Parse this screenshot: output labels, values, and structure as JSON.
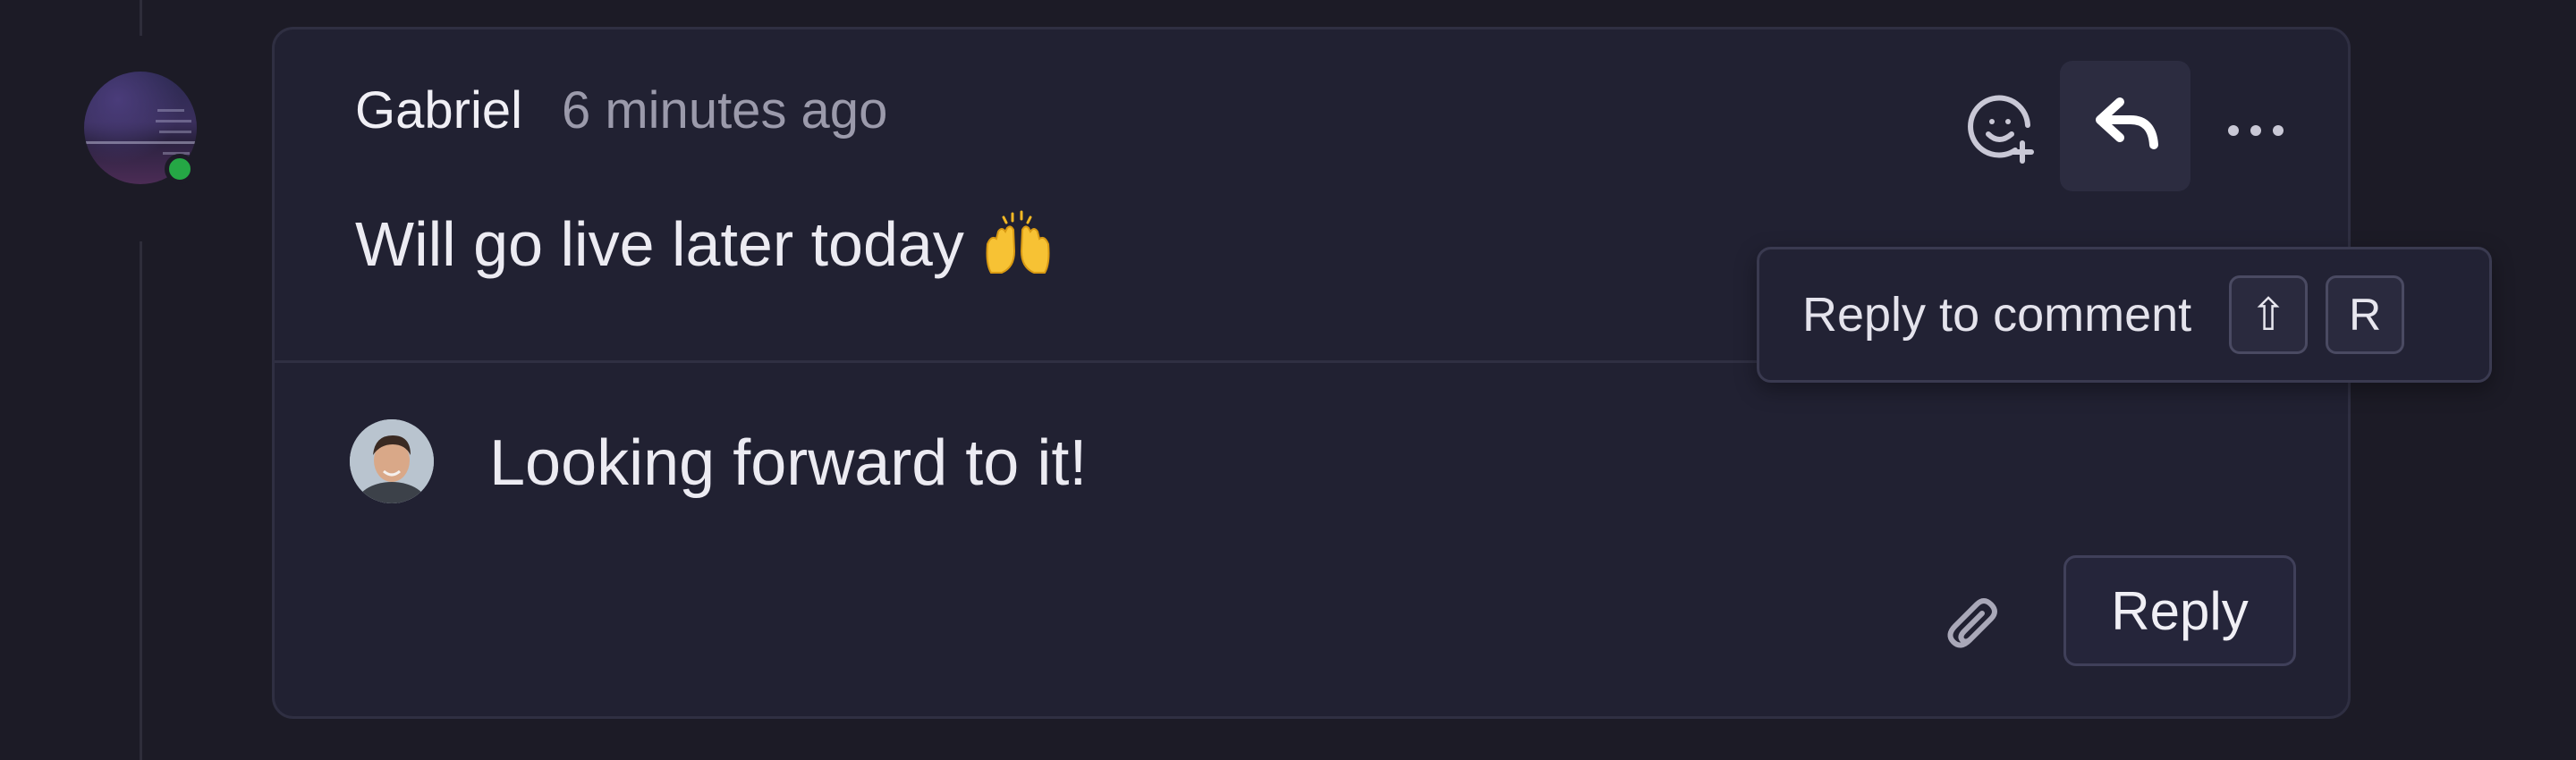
{
  "comment": {
    "author": "Gabriel",
    "timestamp": "6 minutes ago",
    "body": "Will go live later today",
    "body_emoji": "raising-hands-emoji",
    "author_status": "online",
    "status_color": "#25a745"
  },
  "actions": {
    "add_reaction_icon": "emoji-add-icon",
    "reply_icon": "reply-arrow-icon",
    "more_icon": "more-horizontal-icon"
  },
  "tooltip": {
    "label": "Reply to comment",
    "shortcut_keys": [
      "⇧",
      "R"
    ]
  },
  "reply_composer": {
    "value": "Looking forward to it!",
    "attach_icon": "paperclip-icon",
    "submit_label": "Reply"
  },
  "colors": {
    "background": "#1c1b26",
    "card": "#212132",
    "border": "#2f2f42",
    "text": "#ecebf2",
    "muted": "#9b9aab"
  }
}
